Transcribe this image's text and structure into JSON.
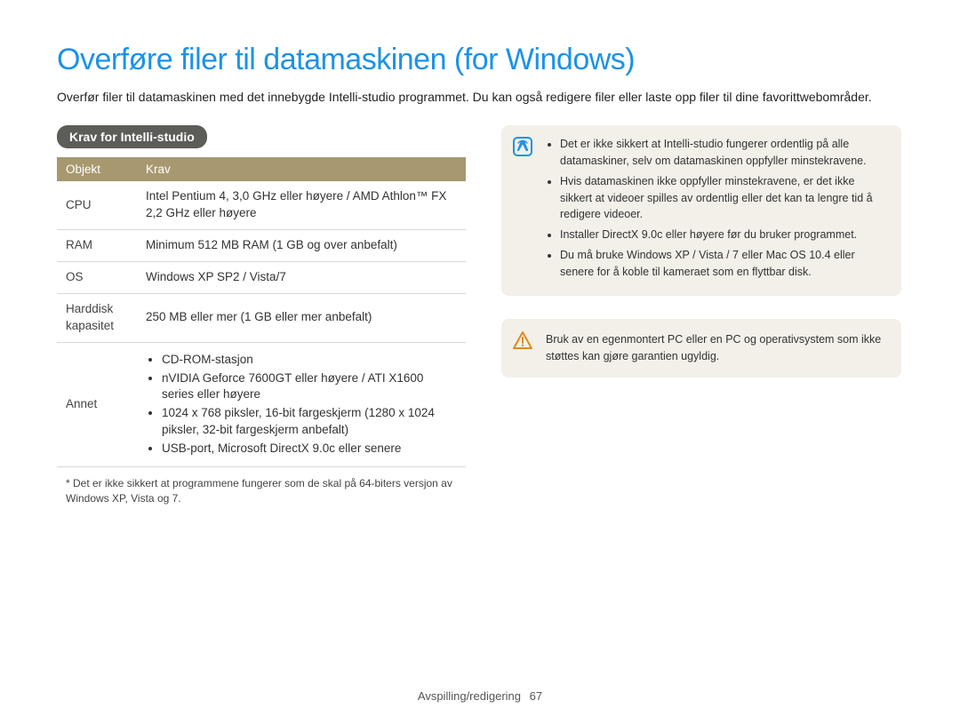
{
  "title": "Overføre filer til datamaskinen (for Windows)",
  "intro": "Overfør filer til datamaskinen med det innebygde Intelli-studio programmet. Du kan også redigere filer eller laste opp filer til dine favorittwebområder.",
  "section_label": "Krav for Intelli-studio",
  "table": {
    "header_obj": "Objekt",
    "header_req": "Krav",
    "rows": [
      {
        "obj": "CPU",
        "req": "Intel Pentium 4, 3,0 GHz eller høyere / AMD Athlon™ FX 2,2 GHz eller høyere"
      },
      {
        "obj": "RAM",
        "req": "Minimum 512 MB RAM (1 GB og over anbefalt)"
      },
      {
        "obj": "OS",
        "req": "Windows XP SP2 / Vista/7"
      },
      {
        "obj": "Harddisk kapasitet",
        "req": "250 MB eller mer (1 GB eller mer anbefalt)"
      }
    ],
    "annet_label": "Annet",
    "annet_items": [
      "CD-ROM-stasjon",
      "nVIDIA Geforce 7600GT eller høyere / ATI X1600 series eller høyere",
      "1024 x 768 piksler, 16-bit fargeskjerm (1280 x 1024 piksler, 32-bit fargeskjerm anbefalt)",
      "USB-port, Microsoft DirectX 9.0c eller senere"
    ]
  },
  "footnote": "* Det er ikke sikkert at programmene fungerer som de skal på 64-biters versjon av Windows XP, Vista og 7.",
  "info_notes": [
    "Det er ikke sikkert at Intelli-studio fungerer ordentlig på alle datamaskiner, selv om datamaskinen oppfyller minstekravene.",
    "Hvis datamaskinen ikke oppfyller minstekravene, er det ikke sikkert at videoer spilles av ordentlig eller det kan ta lengre tid å redigere videoer.",
    "Installer DirectX 9.0c eller høyere før du bruker programmet.",
    "Du må bruke Windows XP / Vista / 7 eller Mac OS 10.4 eller senere for å koble til kameraet som en flyttbar disk."
  ],
  "warning": "Bruk av en egenmontert PC eller en PC og operativsystem som ikke støttes kan gjøre garantien ugyldig.",
  "footer_section": "Avspilling/redigering",
  "footer_page": "67"
}
